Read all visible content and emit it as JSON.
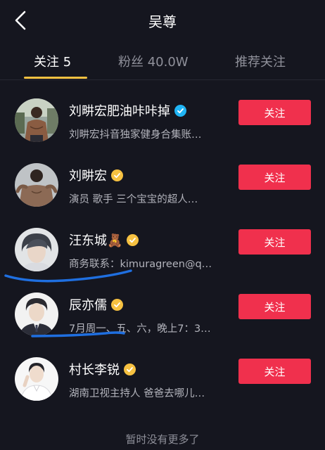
{
  "header": {
    "title": "吴尊",
    "back_icon": "chevron-left-icon"
  },
  "tabs": [
    {
      "label": "关注 5",
      "active": true
    },
    {
      "label": "粉丝  40.0W",
      "active": false
    },
    {
      "label": "推荐关注",
      "active": false
    }
  ],
  "users": [
    {
      "name": "刘畊宏肥油咔咔掉",
      "badge": "blue-verified-icon",
      "desc": "刘畊宏抖音独家健身合集账…",
      "button": "关注"
    },
    {
      "name": "刘畊宏",
      "badge": "gold-verified-icon",
      "desc": "演员  歌手  三个宝宝的超人…",
      "button": "关注"
    },
    {
      "name": "汪东城🧸",
      "badge": "gold-verified-icon",
      "desc": "商务联系：kimuragreen@q…",
      "button": "关注"
    },
    {
      "name": "辰亦儒",
      "badge": "gold-verified-icon",
      "desc": "7月周一、五、六，晚上7：3…",
      "button": "关注"
    },
    {
      "name": "村长李锐",
      "badge": "gold-verified-icon",
      "desc": "湖南卫视主持人  爸爸去哪儿…",
      "button": "关注"
    }
  ],
  "footer": {
    "text": "暂时没有更多了"
  },
  "colors": {
    "background": "#15161f",
    "follow_button": "#f0304d",
    "tab_indicator": "#f6c141",
    "blue_badge": "#20b5f5",
    "gold_badge": "#f6c141",
    "annotation_line": "#1f6fe0"
  }
}
